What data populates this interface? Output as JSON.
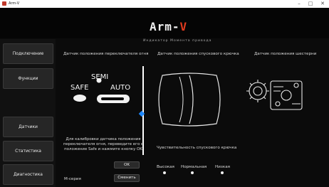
{
  "window": {
    "title": "Arm-V",
    "minimize": "–",
    "maximize": "□",
    "close": "✕"
  },
  "header": {
    "logo_main": "Arm-",
    "logo_accent": "V",
    "subtitle": "Индикатор Момента привода"
  },
  "sidebar": {
    "items": [
      {
        "label": "Подключение"
      },
      {
        "label": "Функции"
      },
      {
        "label": "Датчики"
      },
      {
        "label": "Статистика"
      },
      {
        "label": "Диагностика"
      }
    ]
  },
  "fire_selector": {
    "title": "Датчик положения переключателя огня",
    "semi": "SEMI",
    "safe": "SAFE",
    "auto": "AUTO",
    "instruction": "Для калибровки датчика положения переключателя огня, переведите его в положение Safe и нажмите кнопку OK",
    "ok_label": "OK",
    "serial_label": "М-серия",
    "change_label": "Сменить"
  },
  "trigger": {
    "title": "Датчик положения спускового крючка",
    "sensitivity_title": "Чувствительность спускового крючка",
    "options": [
      "Высокая",
      "Нормальная",
      "Низкая"
    ]
  },
  "gear": {
    "title": "Датчик положения шестерни"
  },
  "colors": {
    "accent": "#e23b1e",
    "marker": "#1e88ff"
  }
}
